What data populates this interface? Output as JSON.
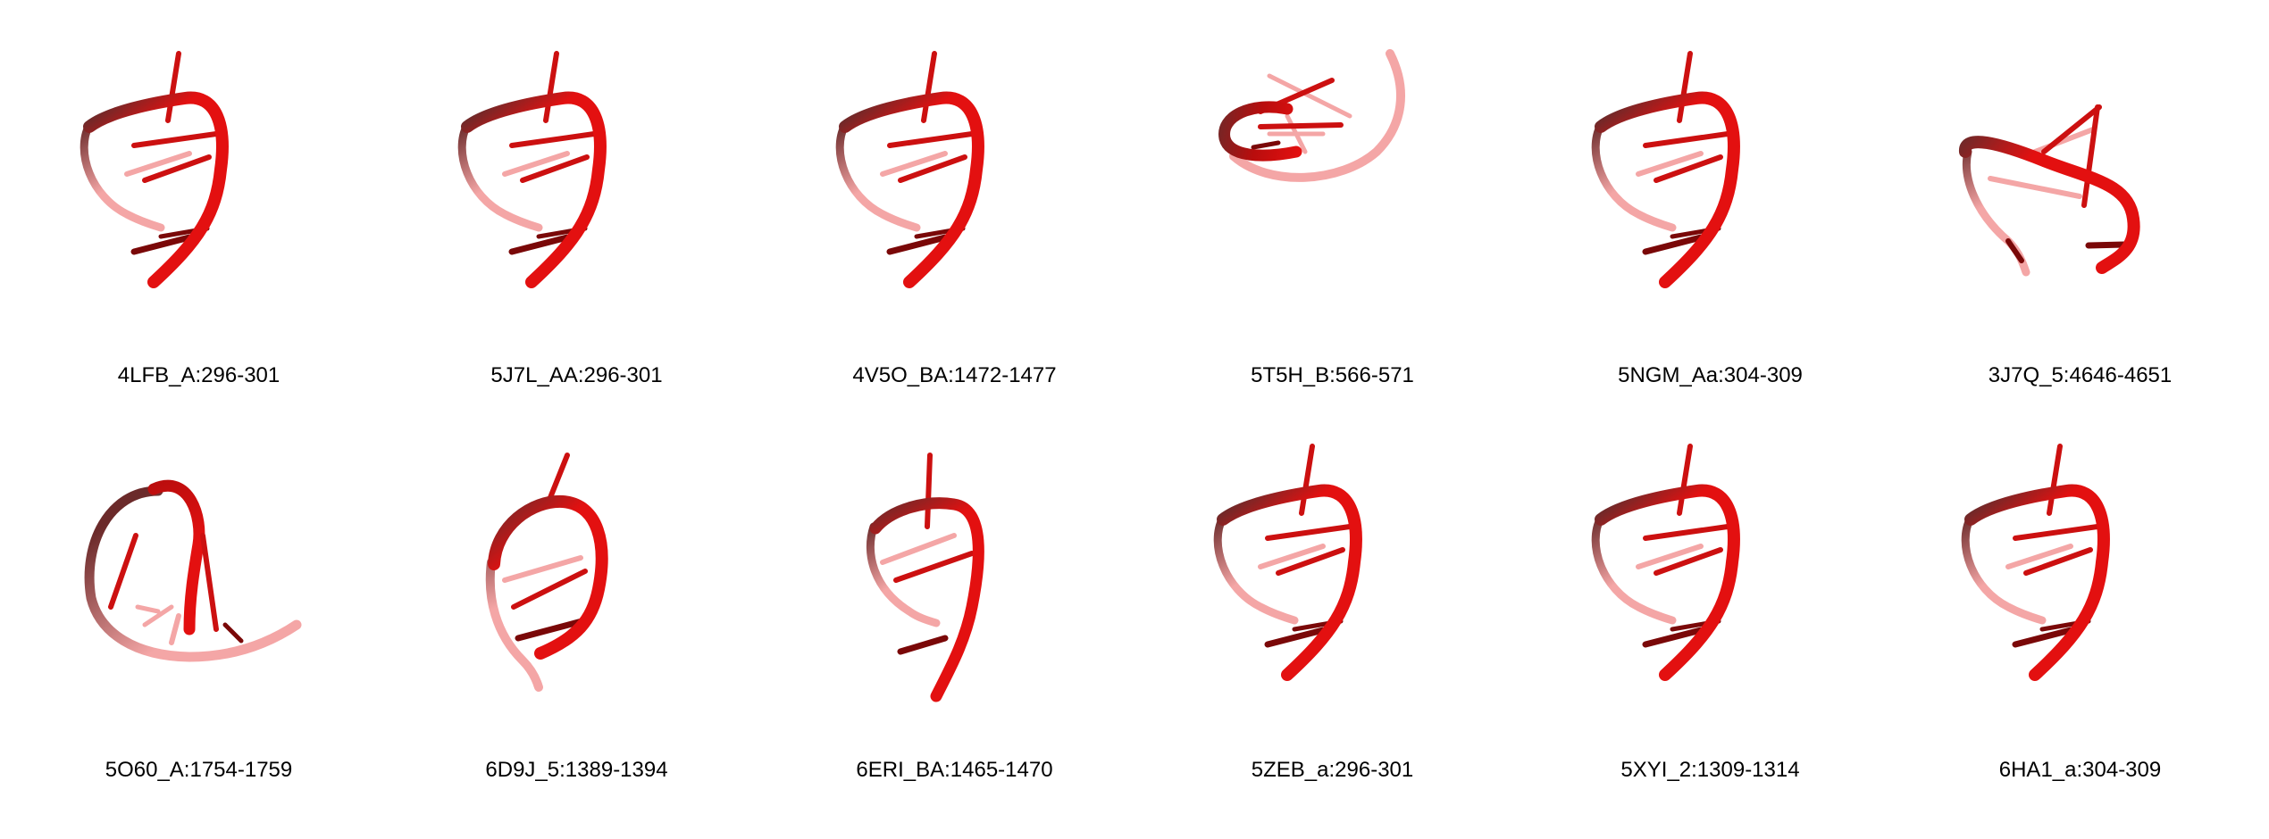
{
  "colors": {
    "strand": "#e31010",
    "strand_dark": "#b80d0d",
    "strand_light": "#f4a6a6",
    "strand_shadow": "#6b2a2a",
    "base_red": "#cc1010",
    "base_dark": "#7a0808",
    "base_light": "#f2b0b0",
    "background": "#ffffff",
    "label": "#000000"
  },
  "panels": [
    {
      "label": "4LFB_A:296-301"
    },
    {
      "label": "5J7L_AA:296-301"
    },
    {
      "label": "4V5O_BA:1472-1477"
    },
    {
      "label": "5T5H_B:566-571"
    },
    {
      "label": "5NGM_Aa:304-309"
    },
    {
      "label": "3J7Q_5:4646-4651"
    },
    {
      "label": "5O60_A:1754-1759"
    },
    {
      "label": "6D9J_5:1389-1394"
    },
    {
      "label": "6ERI_BA:1465-1470"
    },
    {
      "label": "5ZEB_a:296-301"
    },
    {
      "label": "5XYI_2:1309-1314"
    },
    {
      "label": "6HA1_a:304-309"
    }
  ]
}
